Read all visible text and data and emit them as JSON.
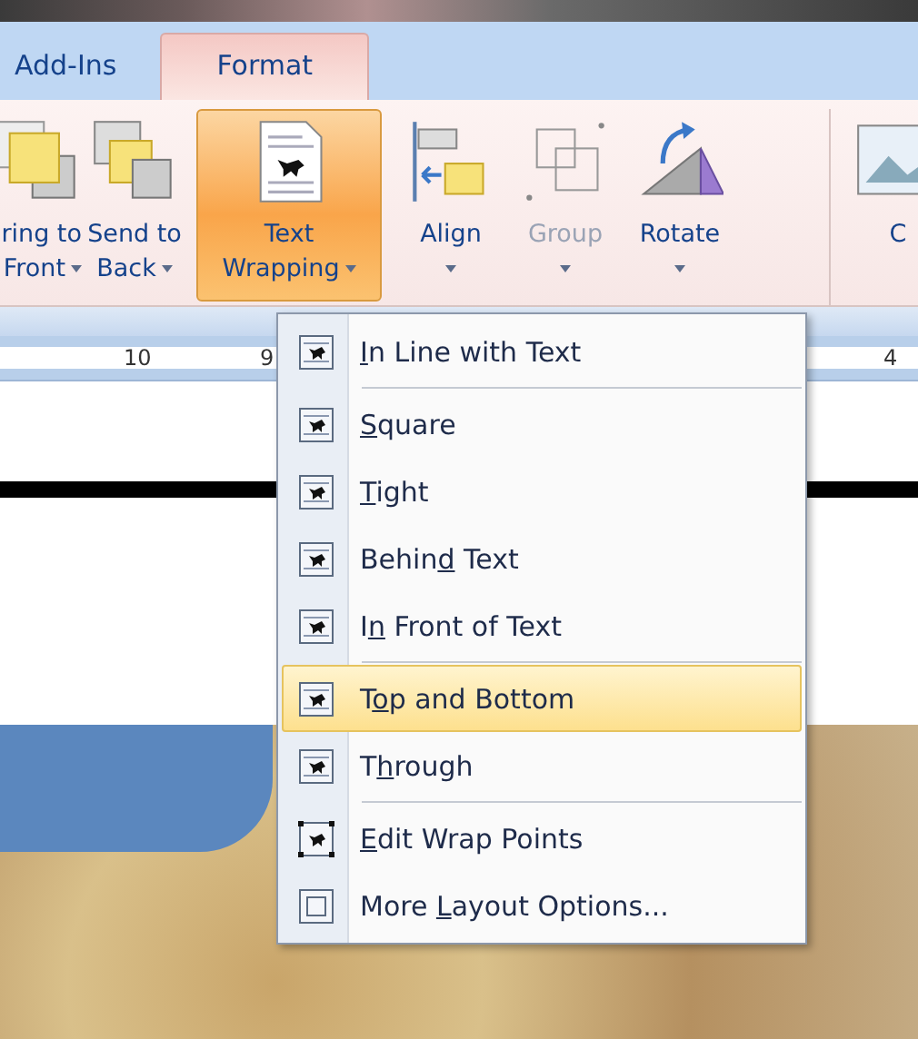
{
  "tabs": [
    {
      "label": "Add-Ins",
      "selected": false
    },
    {
      "label": "Format",
      "selected": true
    }
  ],
  "ribbon_buttons": [
    {
      "kind": "bring-front",
      "line1": "ring to",
      "line2": "Front",
      "dropdown": true,
      "selected": false,
      "disabled": false
    },
    {
      "kind": "send-back",
      "line1": "Send to",
      "line2": "Back",
      "dropdown": true,
      "selected": false,
      "disabled": false
    },
    {
      "kind": "text-wrapping",
      "line1": "Text",
      "line2": "Wrapping",
      "dropdown": true,
      "selected": true,
      "disabled": false
    },
    {
      "kind": "align",
      "line1": "Align",
      "dropdown": true,
      "selected": false,
      "disabled": false
    },
    {
      "kind": "group",
      "line1": "Group",
      "dropdown": true,
      "selected": false,
      "disabled": true
    },
    {
      "kind": "rotate",
      "line1": "Rotate",
      "dropdown": true,
      "selected": false,
      "disabled": false
    },
    {
      "kind": "crop",
      "line1": "C",
      "dropdown": false,
      "selected": false,
      "disabled": false
    }
  ],
  "ruler": {
    "labels": [
      "10",
      "9",
      "4"
    ]
  },
  "menu": {
    "items": [
      {
        "kind": "inline",
        "key": "I",
        "post": "n Line with Text",
        "selected": false,
        "separator_after": true
      },
      {
        "kind": "square",
        "key": "S",
        "post": "quare",
        "selected": false,
        "separator_after": false
      },
      {
        "kind": "tight",
        "key": "T",
        "post": "ight",
        "selected": false,
        "separator_after": false
      },
      {
        "kind": "behind",
        "pre": "Behin",
        "key": "d",
        "post": " Text",
        "selected": false,
        "separator_after": false
      },
      {
        "kind": "front",
        "pre": "I",
        "key": "n",
        "post": " Front of Text",
        "selected": false,
        "separator_after": true
      },
      {
        "kind": "topbottom",
        "pre": "T",
        "key": "o",
        "post": "p and Bottom",
        "selected": true,
        "separator_after": false
      },
      {
        "kind": "through",
        "pre": "T",
        "key": "h",
        "post": "rough",
        "selected": false,
        "separator_after": true
      },
      {
        "kind": "editpoints",
        "key": "E",
        "post": "dit Wrap Points",
        "selected": false,
        "separator_after": false
      },
      {
        "kind": "layout",
        "pre": "More ",
        "key": "L",
        "post": "ayout Options...",
        "selected": false,
        "separator_after": false
      }
    ]
  }
}
